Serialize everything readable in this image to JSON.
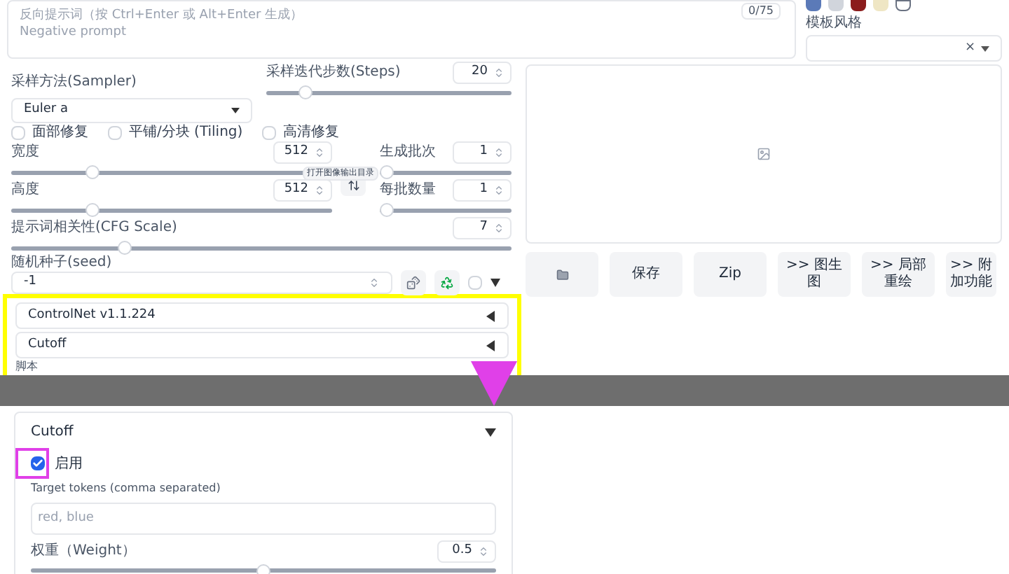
{
  "negative_prompt": {
    "placeholder": "反向提示词（按 Ctrl+Enter 或 Alt+Enter 生成）\nNegative prompt",
    "token_count": "0/75"
  },
  "styles": {
    "label": "模板风格",
    "clear": "×"
  },
  "sampler": {
    "label": "采样方法(Sampler)",
    "value": "Euler a"
  },
  "steps": {
    "label": "采样迭代步数(Steps)",
    "value": "20",
    "level": 0.14
  },
  "options": [
    {
      "label": "面部修复",
      "checked": false
    },
    {
      "label": "平铺/分块 (Tiling)",
      "checked": false
    },
    {
      "label": "高清修复",
      "checked": false
    }
  ],
  "size_sliders": [
    {
      "label": "宽度",
      "value": "512",
      "level": 0.24
    },
    {
      "label": "高度",
      "value": "512",
      "level": 0.24
    }
  ],
  "batch_sliders": [
    {
      "label": "生成批次",
      "value": "1",
      "level": 0
    },
    {
      "label": "每批数量",
      "value": "1",
      "level": 0
    }
  ],
  "swap_tooltip": "打开图像输出目录",
  "cfg": {
    "label": "提示词相关性(CFG Scale)",
    "value": "7",
    "level": 0.22
  },
  "seed": {
    "label": "随机种子(seed)",
    "value": "-1",
    "extra_checked": false
  },
  "accordions": [
    {
      "title": "ControlNet v1.1.224",
      "expanded": false
    },
    {
      "title": "Cutoff",
      "expanded": false
    }
  ],
  "scripts_label": "脚本",
  "output_buttons": [
    {
      "kind": "icon"
    },
    {
      "kind": "text",
      "label": "保存"
    },
    {
      "kind": "text",
      "label": "Zip"
    },
    {
      "kind": "text",
      "label": ">> 图生图"
    },
    {
      "kind": "text",
      "label": ">> 局部重绘"
    },
    {
      "kind": "text",
      "label": ">> 附加功能"
    }
  ],
  "cutoff": {
    "title": "Cutoff",
    "expanded": true,
    "enable": {
      "label": "启用",
      "checked": true
    },
    "tokens": {
      "label": "Target tokens (comma separated)",
      "placeholder": "red, blue"
    },
    "weight": {
      "label": "权重（Weight）",
      "value": "0.5",
      "level": 0.5
    }
  }
}
